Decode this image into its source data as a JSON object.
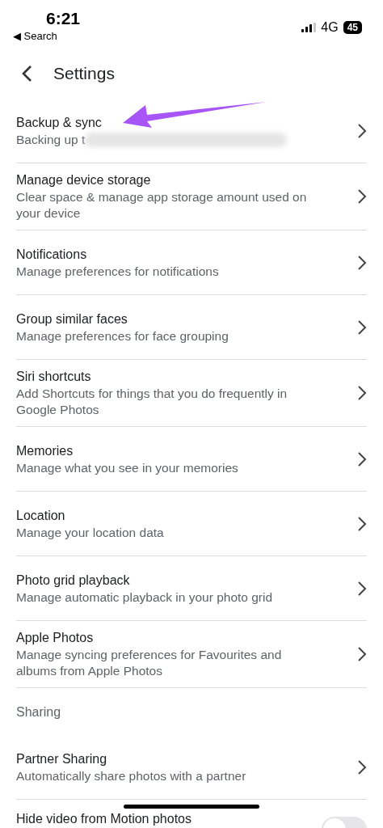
{
  "status_bar": {
    "time": "6:21",
    "back_app": "◀ Search",
    "network": "4G",
    "battery": "45"
  },
  "header": {
    "title": "Settings"
  },
  "items": [
    {
      "kind": "link",
      "title": "Backup & sync",
      "subtitle": "Backing up t",
      "redacted": true
    },
    {
      "kind": "link",
      "title": "Manage device storage",
      "subtitle": "Clear space & manage app storage amount used on your device"
    },
    {
      "kind": "link",
      "title": "Notifications",
      "subtitle": "Manage preferences for notifications"
    },
    {
      "kind": "link",
      "title": "Group similar faces",
      "subtitle": "Manage preferences for face grouping"
    },
    {
      "kind": "link",
      "title": "Siri shortcuts",
      "subtitle": "Add Shortcuts for things that you do frequently in Google Photos"
    },
    {
      "kind": "link",
      "title": "Memories",
      "subtitle": "Manage what you see in your memories"
    },
    {
      "kind": "link",
      "title": "Location",
      "subtitle": "Manage your location data"
    },
    {
      "kind": "link",
      "title": "Photo grid playback",
      "subtitle": "Manage automatic playback in your photo grid"
    },
    {
      "kind": "link",
      "title": "Apple Photos",
      "subtitle": "Manage syncing preferences for Favourites and albums from Apple Photos"
    },
    {
      "kind": "header",
      "title": "Sharing"
    },
    {
      "kind": "link",
      "title": "Partner Sharing",
      "subtitle": "Automatically share photos with a partner"
    },
    {
      "kind": "toggle",
      "title": "Hide video from Motion photos",
      "checked": false
    }
  ]
}
